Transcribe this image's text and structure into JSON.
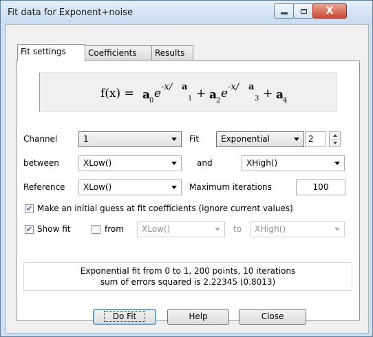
{
  "window": {
    "title": "Fit data for Exponent+noise"
  },
  "titlebar": {
    "minimize_icon": "minimize-icon",
    "maximize_icon": "maximize-icon",
    "close_glyph": "X"
  },
  "tabs": [
    {
      "label": "Fit settings"
    },
    {
      "label": "Coefficients"
    },
    {
      "label": "Results"
    }
  ],
  "formula": {
    "lhs": "f(x) =",
    "a": "a",
    "e": "e",
    "exp_x": "-x/",
    "plus": "+",
    "sub0": "0",
    "sub1": "1",
    "sub2": "2",
    "sub3": "3",
    "sub4": "4"
  },
  "form": {
    "channel_label": "Channel",
    "channel_value": "1",
    "fit_label": "Fit",
    "fit_value": "Exponential",
    "fit_order": "2",
    "between_label": "between",
    "between_value": "XLow()",
    "and_label": "and",
    "and_value": "XHigh()",
    "reference_label": "Reference",
    "reference_value": "XLow()",
    "max_iter_label": "Maximum iterations",
    "max_iter_value": "100",
    "initial_guess_label": "Make an initial guess at fit coefficients (ignore current values)",
    "initial_guess_checked": true,
    "show_fit_label": "Show fit",
    "show_fit_checked": true,
    "from_label": "from",
    "from_checked": false,
    "from_value": "XLow()",
    "to_label": "to",
    "to_value": "XHigh()"
  },
  "status": {
    "line1": "Exponential fit from 0 to 1, 200 points, 10 iterations",
    "line2": "sum of errors squared is 2.22345 (0.8013)"
  },
  "buttons": {
    "do_fit": "Do Fit",
    "help": "Help",
    "close": "Close"
  }
}
